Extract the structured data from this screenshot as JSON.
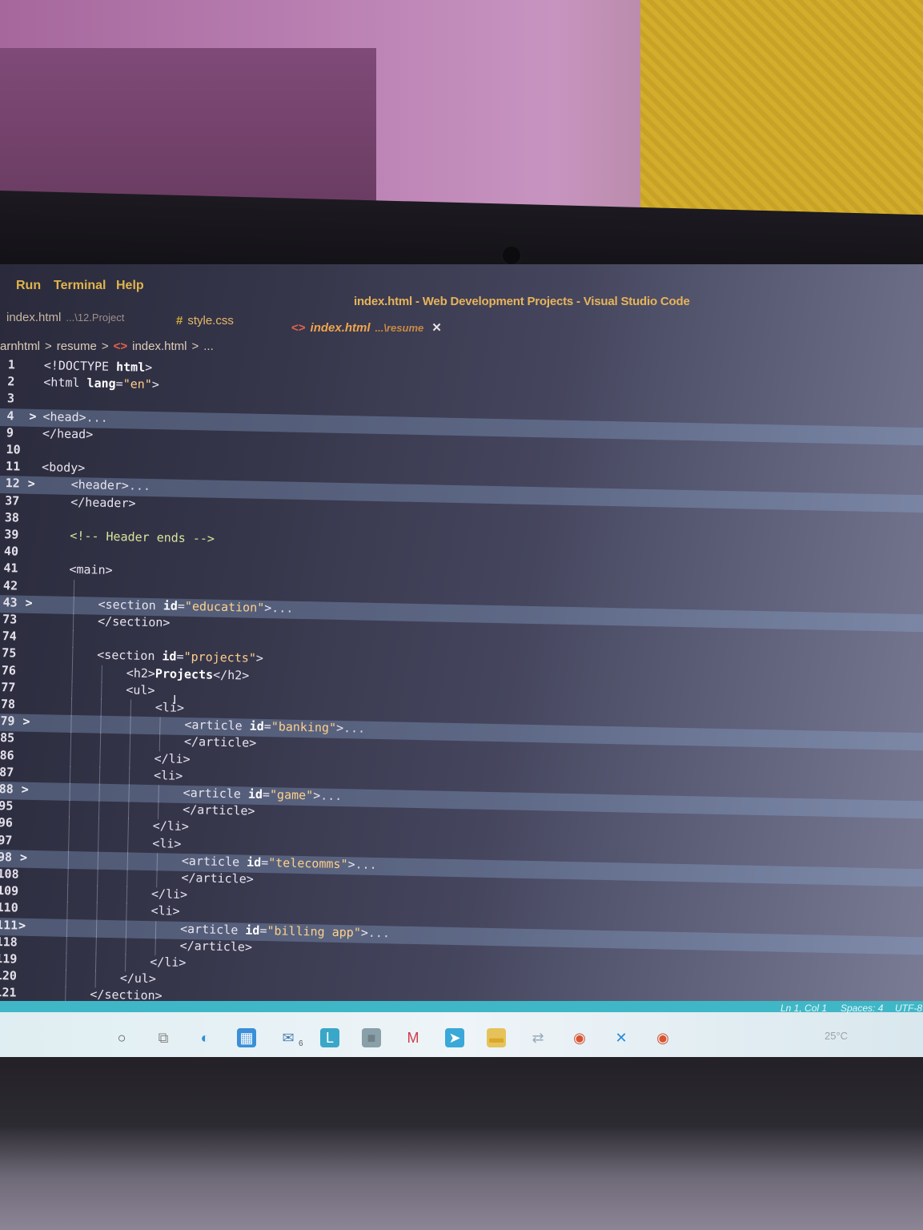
{
  "menu": {
    "items": [
      "Run",
      "Terminal",
      "Help"
    ]
  },
  "window": {
    "title": "index.html - Web Development Projects - Visual Studio Code"
  },
  "tabs": [
    {
      "label": "index.html",
      "path": "...\\12.Project",
      "icon": "html-angle-icon",
      "active": false
    },
    {
      "label": "style.css",
      "path": "",
      "icon": "css-hash-icon",
      "active": false
    },
    {
      "label": "index.html",
      "path": "...\\resume",
      "icon": "html-angle-icon",
      "active": true,
      "close": "✕"
    }
  ],
  "breadcrumb": {
    "items": [
      "arnhtml",
      "resume",
      "index.html",
      "..."
    ]
  },
  "editor": {
    "lines": [
      {
        "n": "1",
        "fold": "",
        "ind": 0,
        "html": [
          [
            "tag",
            "<!"
          ],
          [
            "tag",
            "DOCTYPE "
          ],
          [
            "attr",
            "html"
          ],
          [
            "tag",
            ">"
          ]
        ]
      },
      {
        "n": "2",
        "fold": "",
        "ind": 0,
        "html": [
          [
            "tag",
            "<html "
          ],
          [
            "attr",
            "lang"
          ],
          [
            "tag",
            "="
          ],
          [
            "str",
            "\"en\""
          ],
          [
            "tag",
            ">"
          ]
        ]
      },
      {
        "n": "3",
        "fold": "",
        "ind": 0,
        "html": []
      },
      {
        "n": "4",
        "fold": ">",
        "ind": 0,
        "html": [
          [
            "tag",
            "<head>"
          ],
          [
            "ell",
            "..."
          ]
        ]
      },
      {
        "n": "9",
        "fold": "",
        "ind": 0,
        "html": [
          [
            "tag",
            "</head>"
          ]
        ]
      },
      {
        "n": "10",
        "fold": "",
        "ind": 0,
        "html": []
      },
      {
        "n": "11",
        "fold": "",
        "ind": 0,
        "html": [
          [
            "tag",
            "<body>"
          ]
        ]
      },
      {
        "n": "12",
        "fold": ">",
        "ind": 1,
        "html": [
          [
            "tag",
            "<header>"
          ],
          [
            "ell",
            "..."
          ]
        ]
      },
      {
        "n": "37",
        "fold": "",
        "ind": 1,
        "html": [
          [
            "tag",
            "</header>"
          ]
        ]
      },
      {
        "n": "38",
        "fold": "",
        "ind": 1,
        "html": []
      },
      {
        "n": "39",
        "fold": "",
        "ind": 1,
        "html": [
          [
            "cmt",
            "<!-- Header ends -->"
          ]
        ]
      },
      {
        "n": "40",
        "fold": "",
        "ind": 1,
        "html": []
      },
      {
        "n": "41",
        "fold": "",
        "ind": 1,
        "html": [
          [
            "tag",
            "<main>"
          ]
        ]
      },
      {
        "n": "42",
        "fold": "",
        "ind": 2,
        "html": []
      },
      {
        "n": "43",
        "fold": ">",
        "ind": 2,
        "html": [
          [
            "tag",
            "<section "
          ],
          [
            "attr",
            "id"
          ],
          [
            "tag",
            "="
          ],
          [
            "str",
            "\"education\""
          ],
          [
            "tag",
            ">"
          ],
          [
            "ell",
            "..."
          ]
        ]
      },
      {
        "n": "73",
        "fold": "",
        "ind": 2,
        "html": [
          [
            "tag",
            "</section>"
          ]
        ]
      },
      {
        "n": "74",
        "fold": "",
        "ind": 2,
        "html": []
      },
      {
        "n": "75",
        "fold": "",
        "ind": 2,
        "html": [
          [
            "tag",
            "<section "
          ],
          [
            "attr",
            "id"
          ],
          [
            "tag",
            "="
          ],
          [
            "str",
            "\"projects\""
          ],
          [
            "tag",
            ">"
          ]
        ]
      },
      {
        "n": "76",
        "fold": "",
        "ind": 3,
        "html": [
          [
            "tag",
            "<h2>"
          ],
          [
            "attr",
            "Projects"
          ],
          [
            "tag",
            "</h2>"
          ]
        ]
      },
      {
        "n": "77",
        "fold": "",
        "ind": 3,
        "html": [
          [
            "tag",
            "<ul>"
          ]
        ]
      },
      {
        "n": "78",
        "fold": "",
        "ind": 4,
        "html": [
          [
            "tag",
            "<li>"
          ]
        ]
      },
      {
        "n": "79",
        "fold": ">",
        "ind": 5,
        "html": [
          [
            "tag",
            "<article "
          ],
          [
            "attr",
            "id"
          ],
          [
            "tag",
            "="
          ],
          [
            "str",
            "\"banking\""
          ],
          [
            "tag",
            ">"
          ],
          [
            "ell",
            "..."
          ]
        ]
      },
      {
        "n": "85",
        "fold": "",
        "ind": 5,
        "html": [
          [
            "tag",
            "</article>"
          ]
        ]
      },
      {
        "n": "86",
        "fold": "",
        "ind": 4,
        "html": [
          [
            "tag",
            "</li>"
          ]
        ]
      },
      {
        "n": "87",
        "fold": "",
        "ind": 4,
        "html": [
          [
            "tag",
            "<li>"
          ]
        ]
      },
      {
        "n": "88",
        "fold": ">",
        "ind": 5,
        "html": [
          [
            "tag",
            "<article "
          ],
          [
            "attr",
            "id"
          ],
          [
            "tag",
            "="
          ],
          [
            "str",
            "\"game\""
          ],
          [
            "tag",
            ">"
          ],
          [
            "ell",
            "..."
          ]
        ]
      },
      {
        "n": "95",
        "fold": "",
        "ind": 5,
        "html": [
          [
            "tag",
            "</article>"
          ]
        ]
      },
      {
        "n": "96",
        "fold": "",
        "ind": 4,
        "html": [
          [
            "tag",
            "</li>"
          ]
        ]
      },
      {
        "n": "97",
        "fold": "",
        "ind": 4,
        "html": [
          [
            "tag",
            "<li>"
          ]
        ]
      },
      {
        "n": "98",
        "fold": ">",
        "ind": 5,
        "html": [
          [
            "tag",
            "<article "
          ],
          [
            "attr",
            "id"
          ],
          [
            "tag",
            "="
          ],
          [
            "str",
            "\"telecomms\""
          ],
          [
            "tag",
            ">"
          ],
          [
            "ell",
            "..."
          ]
        ]
      },
      {
        "n": "108",
        "fold": "",
        "ind": 5,
        "html": [
          [
            "tag",
            "</article>"
          ]
        ]
      },
      {
        "n": "109",
        "fold": "",
        "ind": 4,
        "html": [
          [
            "tag",
            "</li>"
          ]
        ]
      },
      {
        "n": "110",
        "fold": "",
        "ind": 4,
        "html": [
          [
            "tag",
            "<li>"
          ]
        ]
      },
      {
        "n": "111",
        "fold": ">",
        "ind": 5,
        "html": [
          [
            "tag",
            "<article "
          ],
          [
            "attr",
            "id"
          ],
          [
            "tag",
            "="
          ],
          [
            "str",
            "\"billing app\""
          ],
          [
            "tag",
            ">"
          ],
          [
            "ell",
            "..."
          ]
        ]
      },
      {
        "n": "118",
        "fold": "",
        "ind": 5,
        "html": [
          [
            "tag",
            "</article>"
          ]
        ]
      },
      {
        "n": "119",
        "fold": "",
        "ind": 4,
        "html": [
          [
            "tag",
            "</li>"
          ]
        ]
      },
      {
        "n": "120",
        "fold": "",
        "ind": 3,
        "html": [
          [
            "tag",
            "</ul>"
          ]
        ]
      },
      {
        "n": "121",
        "fold": "",
        "ind": 2,
        "html": [
          [
            "tag",
            "</section>"
          ]
        ]
      }
    ],
    "highlighted_lines": [
      "4",
      "12",
      "43",
      "79",
      "88",
      "98",
      "111"
    ]
  },
  "statusbar": {
    "position": "Ln 1, Col 1",
    "spaces": "Spaces: 4",
    "encoding": "UTF-8"
  },
  "taskbar": {
    "weather": "25°C",
    "badge": "6",
    "icons": [
      "search-circle-icon",
      "task-view-icon",
      "edge-icon",
      "store-icon",
      "mail-icon",
      "l-app-icon",
      "gray-app-icon",
      "mcafee-icon",
      "telegram-icon",
      "file-explorer-icon",
      "transfer-icon",
      "chrome-icon",
      "vscode-icon",
      "chrome-icon"
    ]
  },
  "colors": {
    "menu": "#e0b44c",
    "title": "#e8b45a",
    "string": "#ffd08a",
    "comment": "#d8e59a",
    "statusbar": "#3fb7c6"
  }
}
